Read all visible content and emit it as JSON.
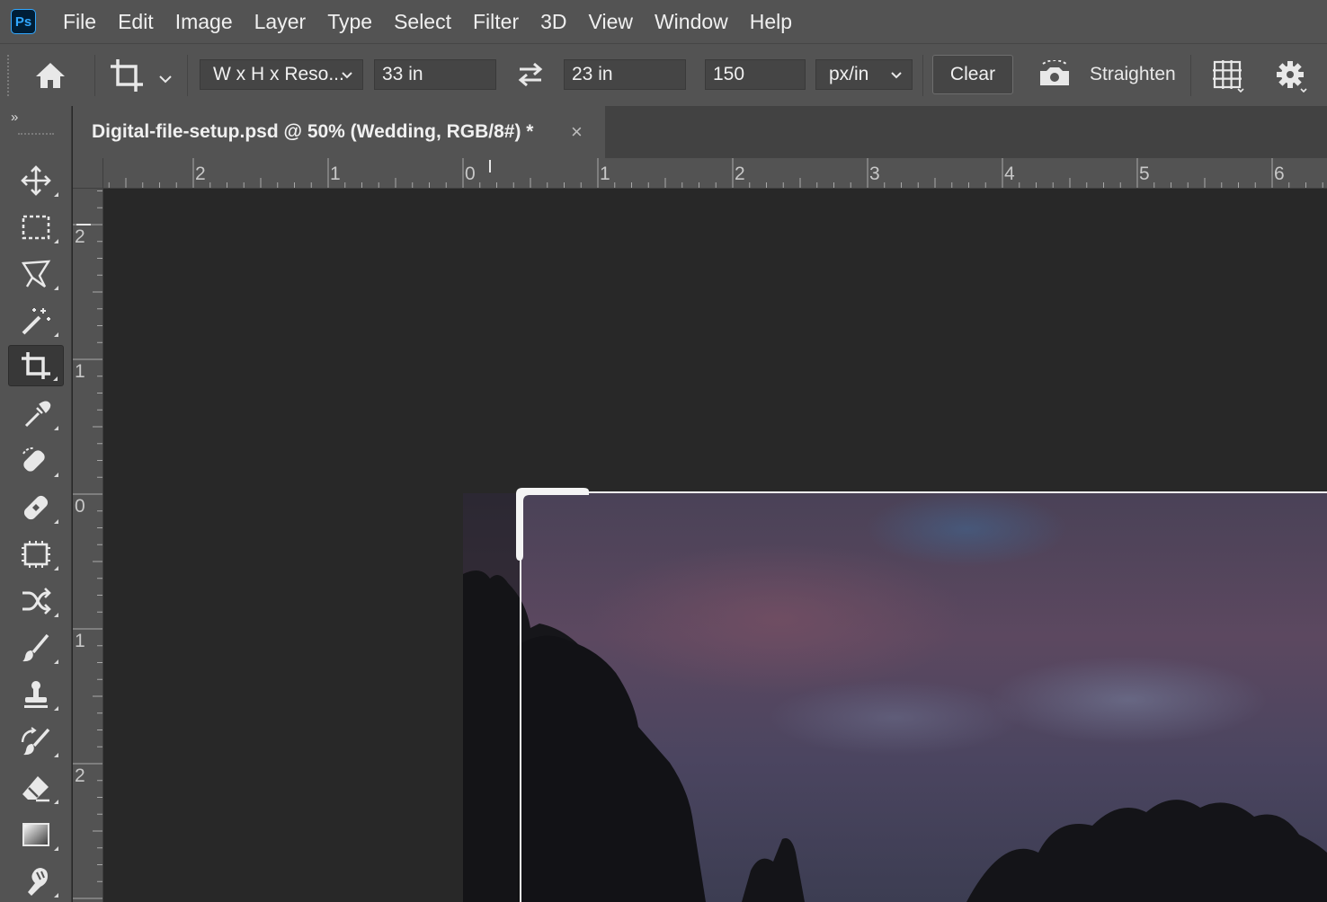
{
  "app": {
    "logo": "Ps"
  },
  "menu": [
    "File",
    "Edit",
    "Image",
    "Layer",
    "Type",
    "Select",
    "Filter",
    "3D",
    "View",
    "Window",
    "Help"
  ],
  "options": {
    "home_icon": "home-icon",
    "crop_tool_icon": "crop-icon",
    "ratio_preset": "W x H x Reso...",
    "width": "33 in",
    "swap_icon": "swap-arrows-icon",
    "height": "23 in",
    "resolution": "150",
    "resolution_unit": "px/in",
    "clear_label": "Clear",
    "straighten_label": "Straighten",
    "overlay_icon": "grid-overlay-icon",
    "settings_icon": "gear-icon"
  },
  "toolbar": {
    "collapse": "»",
    "tools": [
      {
        "name": "move-tool",
        "icon": "move-icon",
        "active": false
      },
      {
        "name": "marquee-tool",
        "icon": "rectangular-marquee-icon",
        "active": false
      },
      {
        "name": "lasso-tool",
        "icon": "polygonal-lasso-icon",
        "active": false
      },
      {
        "name": "magic-wand-tool",
        "icon": "magic-wand-icon",
        "active": false
      },
      {
        "name": "crop-tool",
        "icon": "crop-icon",
        "active": true
      },
      {
        "name": "eyedropper-tool",
        "icon": "eyedropper-icon",
        "active": false
      },
      {
        "name": "spot-healing-tool",
        "icon": "spot-healing-brush-icon",
        "active": false
      },
      {
        "name": "healing-tool",
        "icon": "healing-brush-icon",
        "active": false
      },
      {
        "name": "patch-tool",
        "icon": "patch-icon",
        "active": false
      },
      {
        "name": "content-aware-move-tool",
        "icon": "content-aware-move-icon",
        "active": false
      },
      {
        "name": "brush-tool",
        "icon": "brush-icon",
        "active": false
      },
      {
        "name": "clone-stamp-tool",
        "icon": "clone-stamp-icon",
        "active": false
      },
      {
        "name": "history-brush-tool",
        "icon": "history-brush-icon",
        "active": false
      },
      {
        "name": "eraser-tool",
        "icon": "eraser-icon",
        "active": false
      },
      {
        "name": "gradient-tool",
        "icon": "gradient-icon",
        "active": false
      },
      {
        "name": "smudge-tool",
        "icon": "smudge-icon",
        "active": false
      }
    ]
  },
  "document": {
    "tab_title": "Digital-file-setup.psd @ 50% (Wedding, RGB/8#) *",
    "close_glyph": "×"
  },
  "rulers": {
    "horizontal": [
      "2",
      "1",
      "0",
      "1",
      "2",
      "3",
      "4",
      "5",
      "6"
    ],
    "vertical": [
      "2",
      "1",
      "0",
      "1",
      "2"
    ]
  }
}
